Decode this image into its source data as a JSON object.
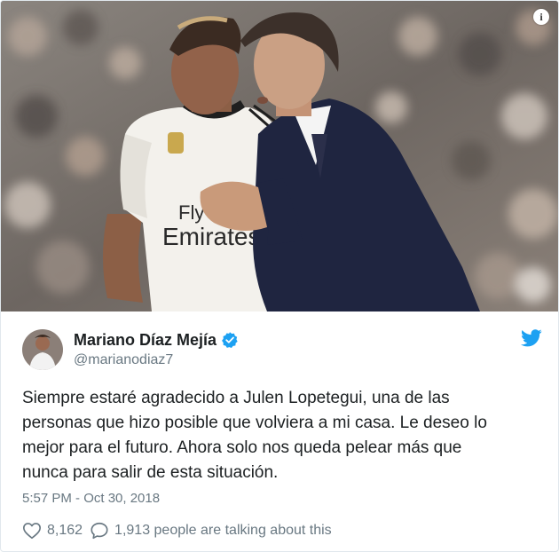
{
  "tweet": {
    "display_name": "Mariano Díaz Mejía",
    "handle": "@marianodiaz7",
    "text": "Siempre estaré agradecido a Julen Lopetegui, una de las\npersonas que hizo posible que volviera a mi casa. Le deseo lo\nmejor para el futuro. Ahora solo nos queda pelear más que\nnunca para salir de esta situación.",
    "timestamp": "5:57 PM - Oct 30, 2018",
    "likes": "8,162",
    "conversation": "1,913 people are talking about this"
  },
  "photo": {
    "info_icon": "info-icon",
    "jersey_text": "Fly Emirates",
    "jersey_lines": [
      "Fly",
      "Emirates"
    ]
  },
  "icons": {
    "verified": "verified-badge-icon",
    "brand": "twitter-bird-icon",
    "like": "heart-icon",
    "reply": "speech-bubble-icon"
  },
  "colors": {
    "twitter_blue": "#1da1f2",
    "text_primary": "#1c2022",
    "text_secondary": "#697882",
    "border": "#e1e8ed"
  }
}
